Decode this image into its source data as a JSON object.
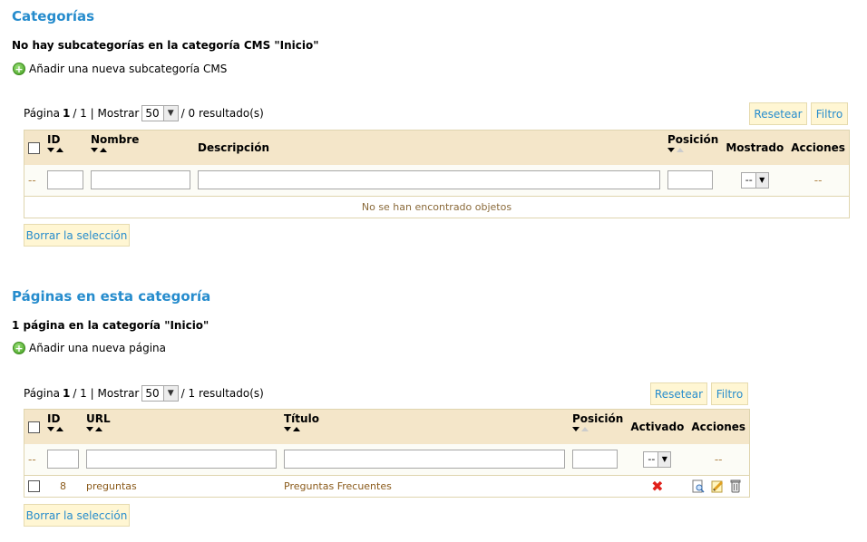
{
  "categories": {
    "title": "Categorías",
    "subtitle": "No hay subcategorías en la categoría CMS \"Inicio\"",
    "add_label": "Añadir una nueva subcategoría CMS",
    "pager": {
      "prefix": "Página",
      "page": "1",
      "sep": "/ 1 | Mostrar",
      "per_page": "50",
      "suffix": "/ 0 resultado(s)"
    },
    "reset_label": "Resetear",
    "filter_label": "Filtro",
    "columns": {
      "id": "ID",
      "name": "Nombre",
      "description": "Descripción",
      "position": "Posición",
      "shown": "Mostrado",
      "actions": "Acciones"
    },
    "filter_dash": "--",
    "shown_select": "--",
    "actions_dash": "--",
    "empty_message": "No se han encontrado objetos",
    "clear_selection": "Borrar la selección"
  },
  "pages": {
    "title": "Páginas en esta categoría",
    "subtitle": "1 página en la categoría \"Inicio\"",
    "add_label": "Añadir una nueva página",
    "pager": {
      "prefix": "Página",
      "page": "1",
      "sep": "/ 1 | Mostrar",
      "per_page": "50",
      "suffix": "/ 1 resultado(s)"
    },
    "reset_label": "Resetear",
    "filter_label": "Filtro",
    "columns": {
      "id": "ID",
      "url": "URL",
      "title": "Título",
      "position": "Posición",
      "active": "Activado",
      "actions": "Acciones"
    },
    "filter_dash": "--",
    "active_select": "--",
    "actions_dash": "--",
    "rows": [
      {
        "id": "8",
        "url": "preguntas",
        "title": "Preguntas Frecuentes",
        "active": false
      }
    ],
    "clear_selection": "Borrar la selección"
  },
  "colors": {
    "heading": "#268ccd",
    "header_bg": "#f4e6c9",
    "button_bg": "#fff6d3",
    "inactive_x": "#e0201a"
  },
  "icons": [
    "add-icon",
    "view-icon",
    "edit-icon",
    "delete-icon",
    "inactive-icon",
    "sort-desc-icon",
    "sort-asc-icon"
  ]
}
